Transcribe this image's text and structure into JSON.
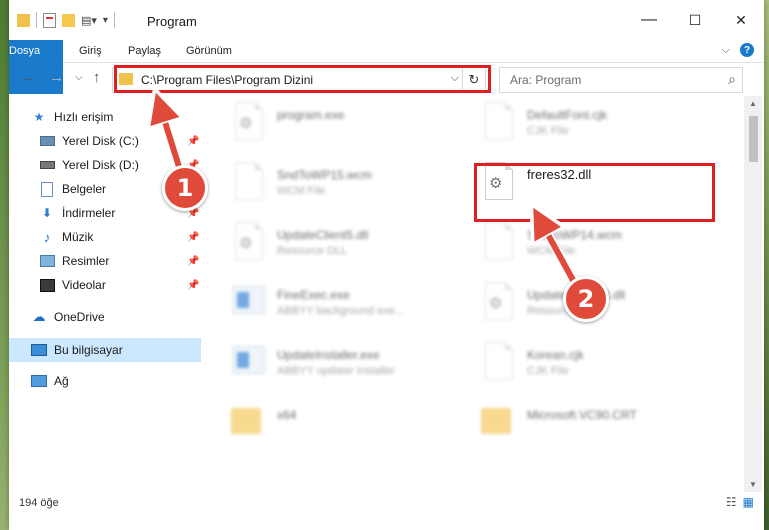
{
  "window": {
    "title": "Program",
    "minimize": "—",
    "maximize": "☐",
    "close": "✕"
  },
  "ribbon": {
    "tabs": [
      "Dosya",
      "Giriş",
      "Paylaş",
      "Görünüm"
    ],
    "expand": "⌵",
    "help": "?"
  },
  "nav": {
    "back": "←",
    "forward": "→",
    "recent": "⌵",
    "up": "↑",
    "address": "C:\\Program Files\\Program Dizini",
    "address_caret": "⌵",
    "refresh": "↻",
    "search_placeholder": "Ara: Program",
    "search_icon": "⌕"
  },
  "sidebar": {
    "quick_access": "Hızlı erişim",
    "items": [
      {
        "label": "Yerel Disk (C:)",
        "icon": "drive-icon"
      },
      {
        "label": "Yerel Disk (D:)",
        "icon": "drive-icon"
      },
      {
        "label": "Belgeler",
        "icon": "documents-icon"
      },
      {
        "label": "İndirmeler",
        "icon": "downloads-icon"
      },
      {
        "label": "Müzik",
        "icon": "music-icon"
      },
      {
        "label": "Resimler",
        "icon": "pictures-icon"
      },
      {
        "label": "Videolar",
        "icon": "videos-icon"
      }
    ],
    "onedrive": "OneDrive",
    "this_pc": "Bu bilgisayar",
    "network": "Ağ"
  },
  "files": [
    {
      "name": "program.exe",
      "type": "",
      "icon": "gear-app-icon"
    },
    {
      "name": "DefaultFont.cjk",
      "type": "CJK File",
      "icon": "blank-file-icon"
    },
    {
      "name": "SndToWP15.wcm",
      "type": "WCM File",
      "icon": "blank-file-icon"
    },
    {
      "name": "freres32.dll",
      "type": "",
      "icon": "dll-gear-icon"
    },
    {
      "name": "UpdateClient5.dll",
      "type": "Resource DLL",
      "icon": "dll-gear-icon"
    },
    {
      "name": "SndToWP14.wcm",
      "type": "WCM File",
      "icon": "blank-file-icon"
    },
    {
      "name": "FineExec.exe",
      "type": "ABBYY background exe...",
      "icon": "app-window-icon"
    },
    {
      "name": "UpdateClient63.dll",
      "type": "Resource DLL",
      "icon": "dll-gear-icon"
    },
    {
      "name": "UpdateInstaller.exe",
      "type": "ABBYY updater installer",
      "icon": "app-window-icon"
    },
    {
      "name": "Korean.cjk",
      "type": "CJK File",
      "icon": "blank-file-icon"
    },
    {
      "name": "x64",
      "type": "",
      "icon": "folder-icon"
    },
    {
      "name": "Microsoft.VC90.CRT",
      "type": "",
      "icon": "folder-icon"
    }
  ],
  "status": {
    "count": "194 öğe"
  },
  "callouts": {
    "one": "1",
    "two": "2"
  },
  "colors": {
    "accent": "#1979ca",
    "highlight": "#e02020",
    "bubble": "#e04a3a",
    "selection": "#cce8ff"
  }
}
